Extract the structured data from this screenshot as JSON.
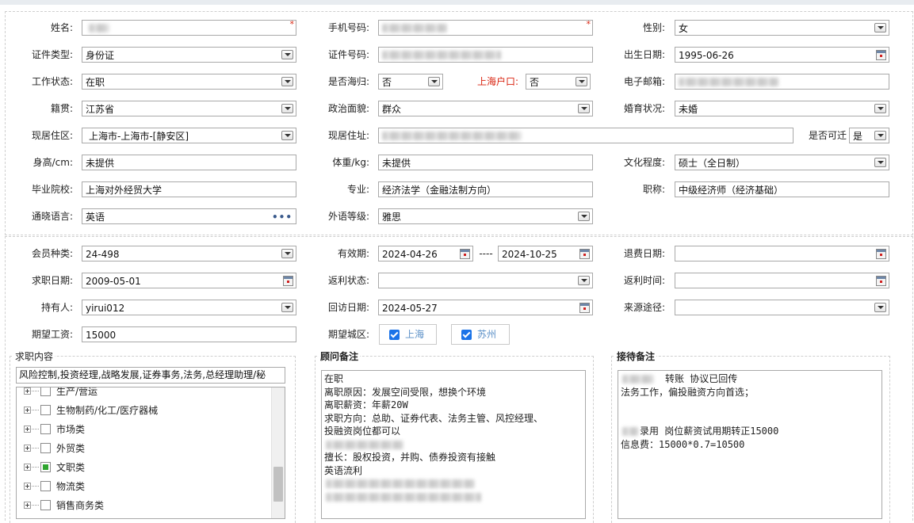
{
  "personal": {
    "name": {
      "label": "姓名:",
      "value": ""
    },
    "phone": {
      "label": "手机号码:",
      "value": ""
    },
    "gender": {
      "label": "性别:",
      "value": "女"
    },
    "id_type": {
      "label": "证件类型:",
      "value": "身份证"
    },
    "id_number": {
      "label": "证件号码:",
      "value": ""
    },
    "birth_date": {
      "label": "出生日期:",
      "value": "1995-06-26"
    },
    "work_status": {
      "label": "工作状态:",
      "value": "在职"
    },
    "returnee": {
      "label": "是否海归:",
      "value": "否"
    },
    "shanghai_hukou": {
      "label": "上海户口:",
      "value": "否"
    },
    "email": {
      "label": "电子邮箱:",
      "value": ""
    },
    "native_place": {
      "label": "籍贯:",
      "value": "江苏省"
    },
    "political": {
      "label": "政治面貌:",
      "value": "群众"
    },
    "marital": {
      "label": "婚育状况:",
      "value": "未婚"
    },
    "residence_area": {
      "label": "现居住区:",
      "value": "上海市-上海市-[静安区]"
    },
    "residence_address": {
      "label": "现居住址:",
      "value": ""
    },
    "relocatable": {
      "label": "是否可迁",
      "value": "是"
    },
    "height": {
      "label": "身高/cm:",
      "value": "未提供"
    },
    "weight": {
      "label": "体重/kg:",
      "value": "未提供"
    },
    "education": {
      "label": "文化程度:",
      "value": "硕士（全日制）"
    },
    "school": {
      "label": "毕业院校:",
      "value": "上海对外经贸大学"
    },
    "major": {
      "label": "专业:",
      "value": "经济法学（金融法制方向）"
    },
    "title": {
      "label": "职称:",
      "value": "中级经济师（经济基础）"
    },
    "languages": {
      "label": "通晓语言:",
      "value": "英语"
    },
    "foreign_level": {
      "label": "外语等级:",
      "value": "雅思"
    }
  },
  "membership": {
    "member_type": {
      "label": "会员种类:",
      "value": "24-498"
    },
    "validity": {
      "label": "有效期:",
      "from": "2024-04-26",
      "separator": "----",
      "to": "2024-10-25"
    },
    "refund_date": {
      "label": "退费日期:",
      "value": ""
    },
    "job_seek_date": {
      "label": "求职日期:",
      "value": "2009-05-01"
    },
    "rebate_status": {
      "label": "返利状态:",
      "value": ""
    },
    "rebate_time": {
      "label": "返利时间:",
      "value": ""
    },
    "holder": {
      "label": "持有人:",
      "value": "yirui012"
    },
    "revisit_date": {
      "label": "回访日期:",
      "value": "2024-05-27"
    },
    "source": {
      "label": "来源途径:",
      "value": ""
    },
    "expected_salary": {
      "label": "期望工资:",
      "value": "15000"
    },
    "expected_city": {
      "label": "期望城区:",
      "options": [
        {
          "label": "上海",
          "checked": true
        },
        {
          "label": "苏州",
          "checked": true
        }
      ]
    }
  },
  "job_content": {
    "title": "求职内容",
    "selected": "风险控制,投资经理,战略发展,证券事务,法务,总经理助理/秘",
    "tree": [
      {
        "label": "生产/营运",
        "state": "none"
      },
      {
        "label": "生物制药/化工/医疗器械",
        "state": "none"
      },
      {
        "label": "市场类",
        "state": "none"
      },
      {
        "label": "外贸类",
        "state": "none"
      },
      {
        "label": "文职类",
        "state": "partial"
      },
      {
        "label": "物流类",
        "state": "none"
      },
      {
        "label": "销售商务类",
        "state": "none"
      }
    ]
  },
  "consultant_notes": {
    "title": "顾问备注",
    "lines": [
      "在职",
      "离职原因：发展空间受限，想换个环境",
      "离职薪资：年薪20W",
      "求职方向：总助、证券代表、法务主管、风控经理、",
      "投融资岗位都可以",
      "",
      "擅长：股权投资，并购、债券投资有接触",
      "英语流利",
      "",
      ""
    ]
  },
  "reception_notes": {
    "title": "接待备注",
    "lines": [
      "转账  协议已回传",
      "法务工作，偏投融资方向首选；",
      "",
      "",
      "录用 岗位薪资试用期转正15000",
      "信息费：15000*0.7=10500"
    ]
  },
  "colors": {
    "required": "#d9230f",
    "checkbox": "#1a73e8",
    "tree_partial": "#2fa52f"
  }
}
